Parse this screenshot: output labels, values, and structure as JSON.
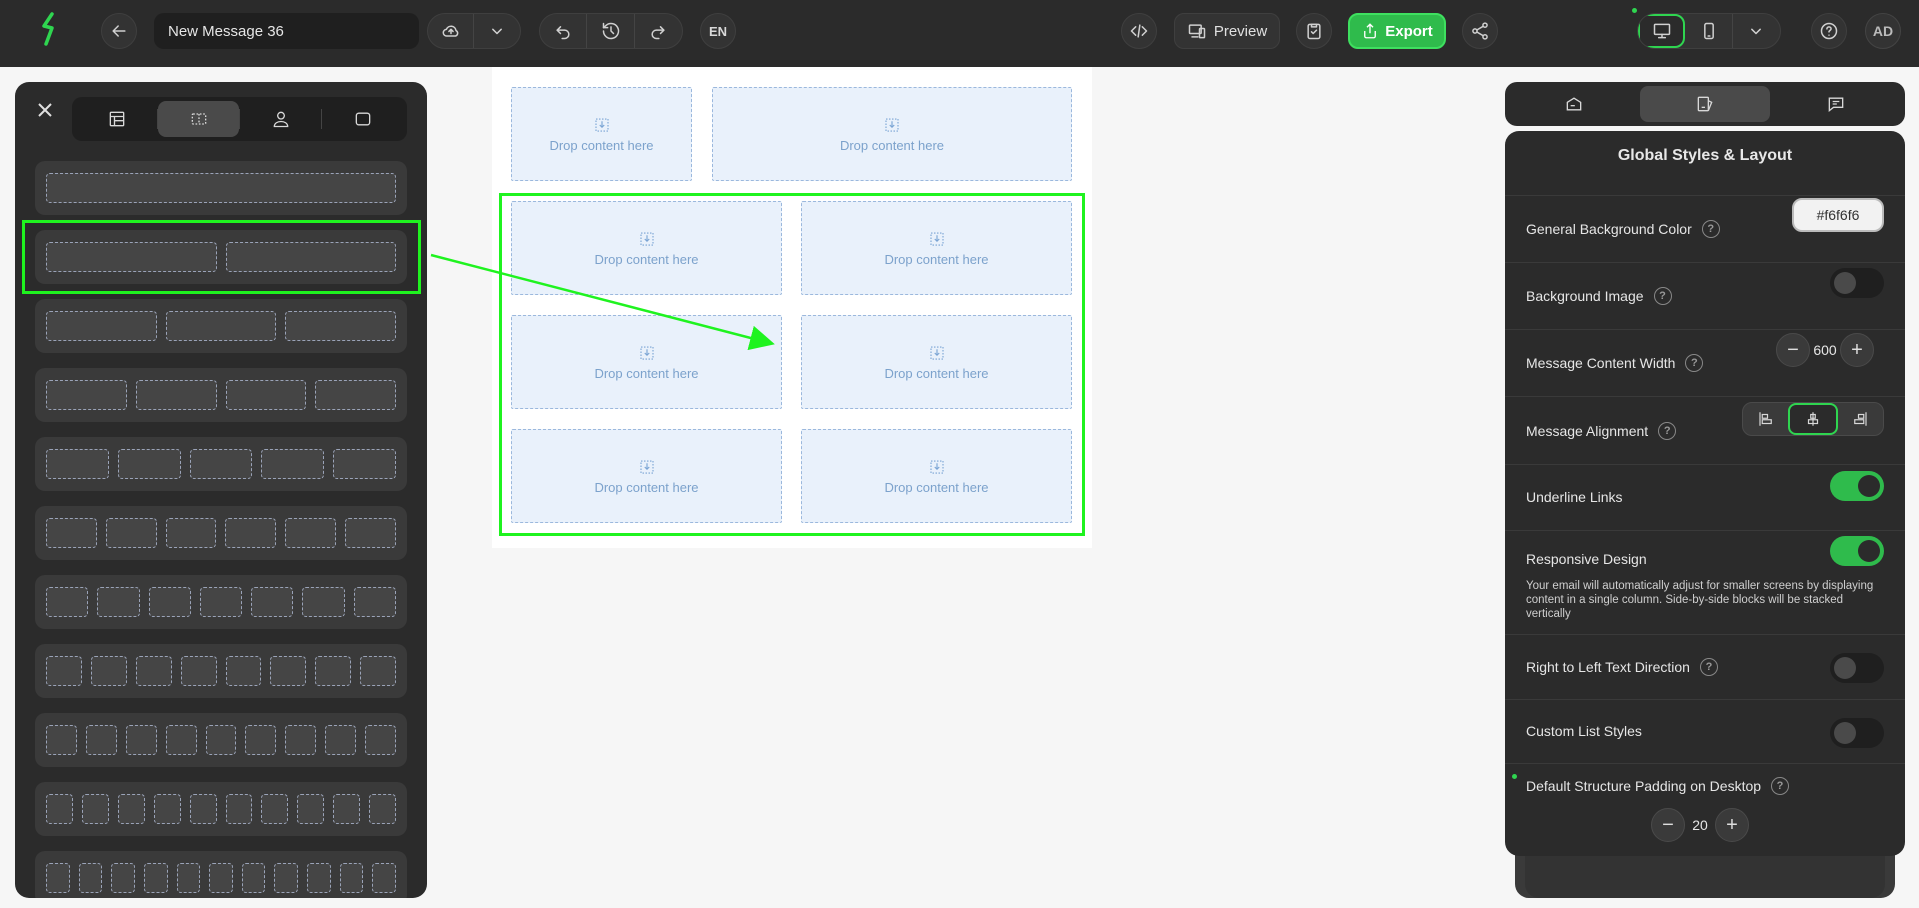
{
  "header": {
    "message_name": "New Message 36",
    "language": "EN",
    "preview_label": "Preview",
    "export_label": "Export",
    "avatar_initials": "AD"
  },
  "left_panel": {
    "tabs": [
      "blocks-icon",
      "structures-icon",
      "modules-icon",
      "templates-icon"
    ],
    "active_tab": 1,
    "structures": [
      {
        "columns": 1
      },
      {
        "columns": 2
      },
      {
        "columns": 3
      },
      {
        "columns": 4
      },
      {
        "columns": 5
      },
      {
        "columns": 6
      },
      {
        "columns": 7
      },
      {
        "columns": 8
      },
      {
        "columns": 9
      },
      {
        "columns": 10
      },
      {
        "columns": 11
      }
    ]
  },
  "canvas": {
    "drop_label": "Drop content here"
  },
  "right_panel": {
    "title": "Global Styles & Layout",
    "general_background_label": "General Background Color",
    "general_background_value": "#f6f6f6",
    "background_image_label": "Background Image",
    "background_image_on": false,
    "content_width_label": "Message Content Width",
    "content_width_value": "600",
    "alignment_label": "Message Alignment",
    "alignment_selected": "center",
    "underline_label": "Underline Links",
    "underline_on": true,
    "responsive_label": "Responsive Design",
    "responsive_on": true,
    "responsive_desc": "Your email will automatically adjust for smaller screens by displaying content in a single column. Side-by-side blocks will be stacked vertically",
    "rtl_label": "Right to Left Text Direction",
    "rtl_on": false,
    "custom_list_label": "Custom List Styles",
    "custom_list_on": false,
    "padding_label": "Default Structure Padding on Desktop",
    "padding_value": "20"
  },
  "colors": {
    "accent": "#2fbb4c",
    "highlight": "#1ff31f",
    "drop_bg": "#e9f1fb"
  }
}
